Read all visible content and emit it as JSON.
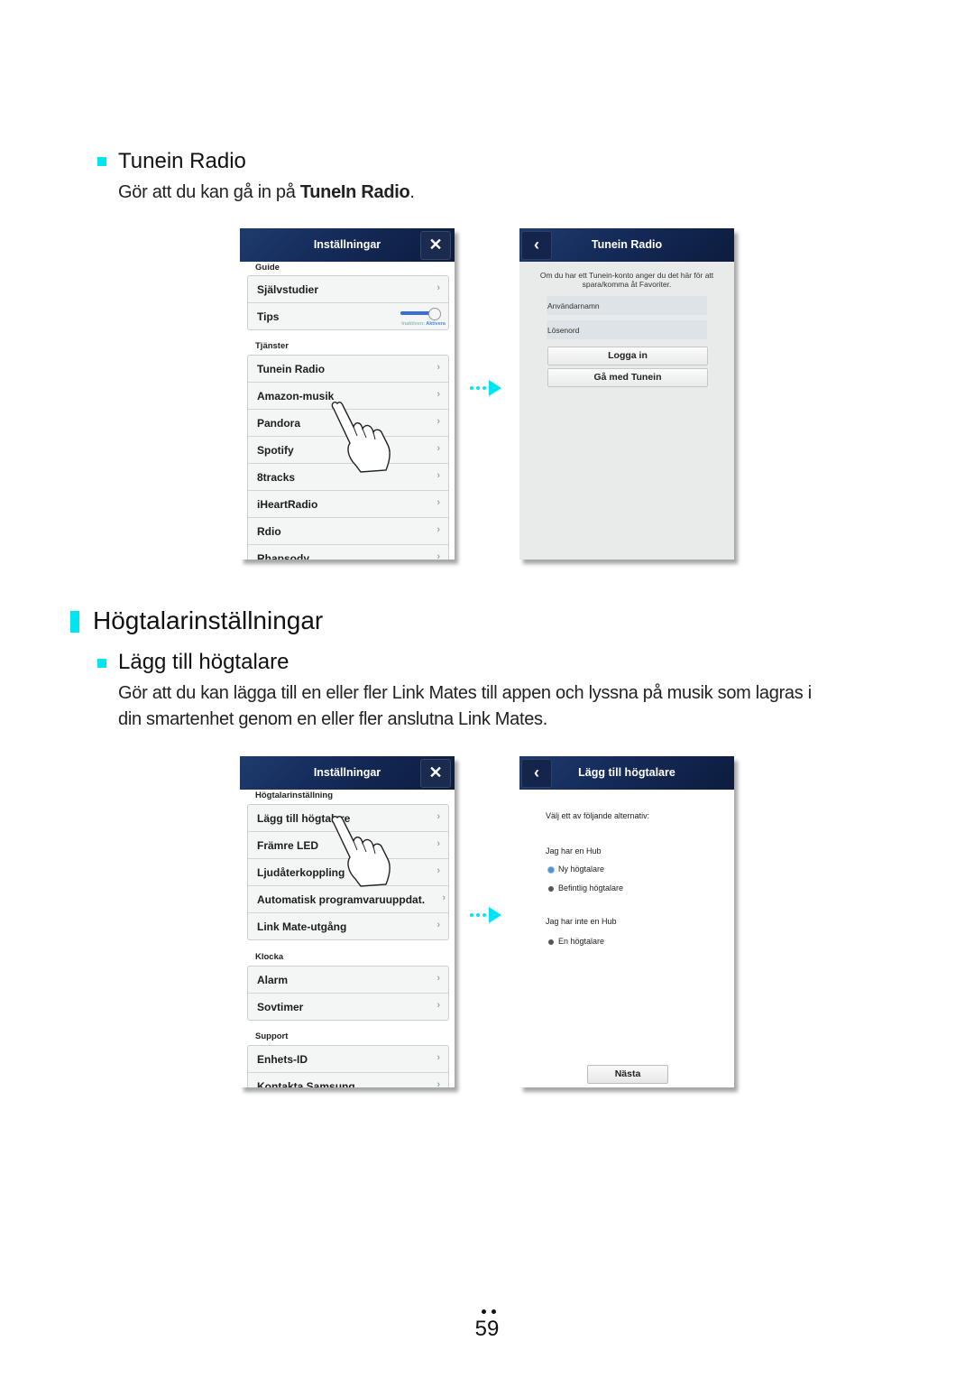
{
  "section1": {
    "heading": "Tunein Radio",
    "desc_prefix": "Gör att du kan gå in på ",
    "desc_bold": "TuneIn Radio",
    "desc_suffix": "."
  },
  "screen_settings1": {
    "title": "Inställningar",
    "close_glyph": "✕",
    "sections": [
      {
        "label": "Guide",
        "items": [
          "Självstudier",
          "Tips"
        ]
      },
      {
        "label": "Tjänster",
        "items": [
          "Tunein Radio",
          "Amazon-musik",
          "Pandora",
          "Spotify",
          "8tracks",
          "iHeartRadio",
          "Rdio",
          "Rhapsody"
        ]
      }
    ],
    "tips_toggle": {
      "state": "on",
      "inactive_label": "Inaktiven:",
      "active_label": "Aktivera"
    },
    "chevron": "›"
  },
  "screen_tunein": {
    "back_glyph": "‹",
    "title": "Tunein Radio",
    "note": "Om du har ett Tunein-konto anger du det här för att spara/komma åt Favoriter.",
    "username_placeholder": "Användarnamn",
    "password_placeholder": "Lösenord",
    "login_button": "Logga in",
    "join_button": "Gå med Tunein"
  },
  "section2": {
    "heading": "Högtalarinställningar",
    "sub_heading": "Lägg till högtalare",
    "desc_line1": "Gör att du kan lägga till en eller fler Link Mates till appen och lyssna på musik som lagras i",
    "desc_line2": "din smartenhet genom en eller fler anslutna Link Mates."
  },
  "screen_settings2": {
    "title": "Inställningar",
    "close_glyph": "✕",
    "sections": [
      {
        "label": "Högtalarinställning",
        "items": [
          "Lägg till högtalare",
          "Främre LED",
          "Ljudåterkoppling",
          "Automatisk programvaruuppdat.",
          "Link Mate-utgång"
        ]
      },
      {
        "label": "Klocka",
        "items": [
          "Alarm",
          "Sovtimer"
        ]
      },
      {
        "label": "Support",
        "items": [
          "Enhets-ID",
          "Kontakta Samsung"
        ]
      }
    ],
    "chevron": "›"
  },
  "screen_add_speaker": {
    "back_glyph": "‹",
    "title": "Lägg till högtalare",
    "prompt": "Välj ett av följande alternativ:",
    "group1_label": "Jag har en Hub",
    "option1": "Ny högtalare",
    "option2": "Befintlig högtalare",
    "group2_label": "Jag har inte en Hub",
    "option3": "En högtalare",
    "selected_option": "Ny högtalare",
    "next_button": "Nästa"
  },
  "accent_color": "#00e5f0",
  "page_number": "59"
}
